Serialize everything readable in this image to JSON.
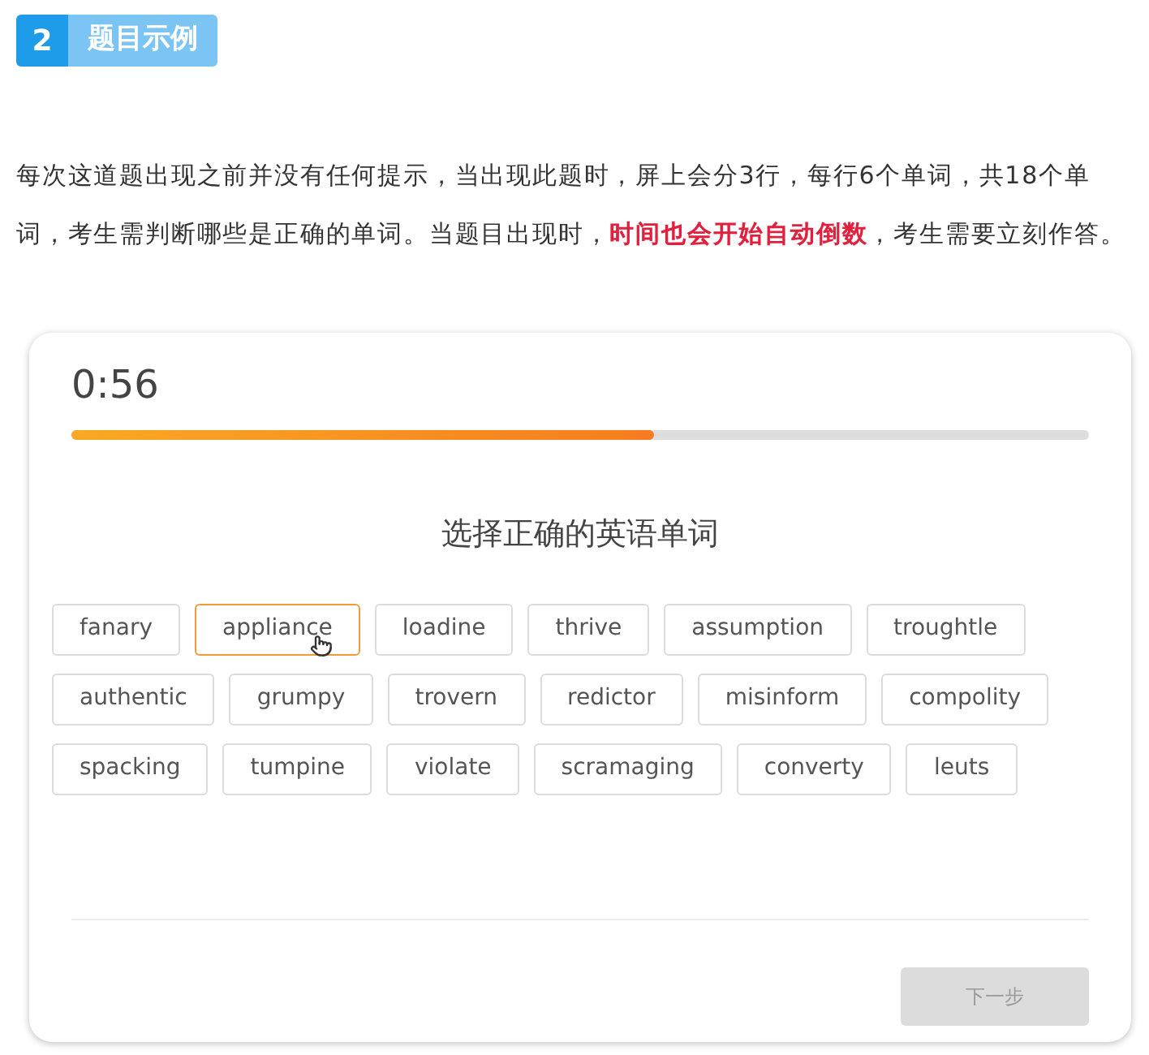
{
  "section": {
    "number": "2",
    "title": "题目示例"
  },
  "paragraph": [
    {
      "kind": "plain",
      "text": "每次这道题出现之前并没有任何提示，当出现此题时，屏上会分3行，每行6个单词，共18个单词，考生需判断哪些是正确的单词。当题目出现时，"
    },
    {
      "kind": "emphasis",
      "text": "时间也会开始自动倒数"
    },
    {
      "kind": "plain",
      "text": "，考生需要立刻作答。"
    }
  ],
  "quiz": {
    "timer": "0:56",
    "progress": {
      "level": 0.573
    },
    "prompt": "选择正确的英语单词",
    "rows": [
      [
        {
          "word": "fanary",
          "hovered": false
        },
        {
          "word": "appliance",
          "hovered": true
        },
        {
          "word": "loadine",
          "hovered": false
        },
        {
          "word": "thrive",
          "hovered": false
        },
        {
          "word": "assumption",
          "hovered": false
        },
        {
          "word": "troughtle",
          "hovered": false
        }
      ],
      [
        {
          "word": "authentic",
          "hovered": false
        },
        {
          "word": "grumpy",
          "hovered": false
        },
        {
          "word": "trovern",
          "hovered": false
        },
        {
          "word": "redictor",
          "hovered": false
        },
        {
          "word": "misinform",
          "hovered": false
        },
        {
          "word": "compolity",
          "hovered": false
        }
      ],
      [
        {
          "word": "spacking",
          "hovered": false
        },
        {
          "word": "tumpine",
          "hovered": false
        },
        {
          "word": "violate",
          "hovered": false
        },
        {
          "word": "scramaging",
          "hovered": false
        },
        {
          "word": "converty",
          "hovered": false
        },
        {
          "word": "leuts",
          "hovered": false
        }
      ]
    ],
    "next_button": {
      "label": "下一步",
      "disabled": true
    }
  }
}
